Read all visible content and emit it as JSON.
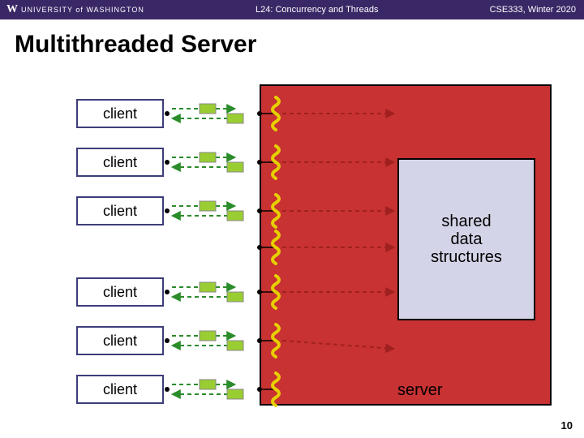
{
  "header": {
    "logo_w": "W",
    "logo_text": "UNIVERSITY of WASHINGTON",
    "center": "L24: Concurrency and Threads",
    "right": "CSE333, Winter 2020"
  },
  "title": "Multithreaded Server",
  "clients": [
    "client",
    "client",
    "client",
    "client",
    "client",
    "client"
  ],
  "shared": {
    "line1": "shared",
    "line2": "data",
    "line3": "structures"
  },
  "server_label": "server",
  "page": "10"
}
